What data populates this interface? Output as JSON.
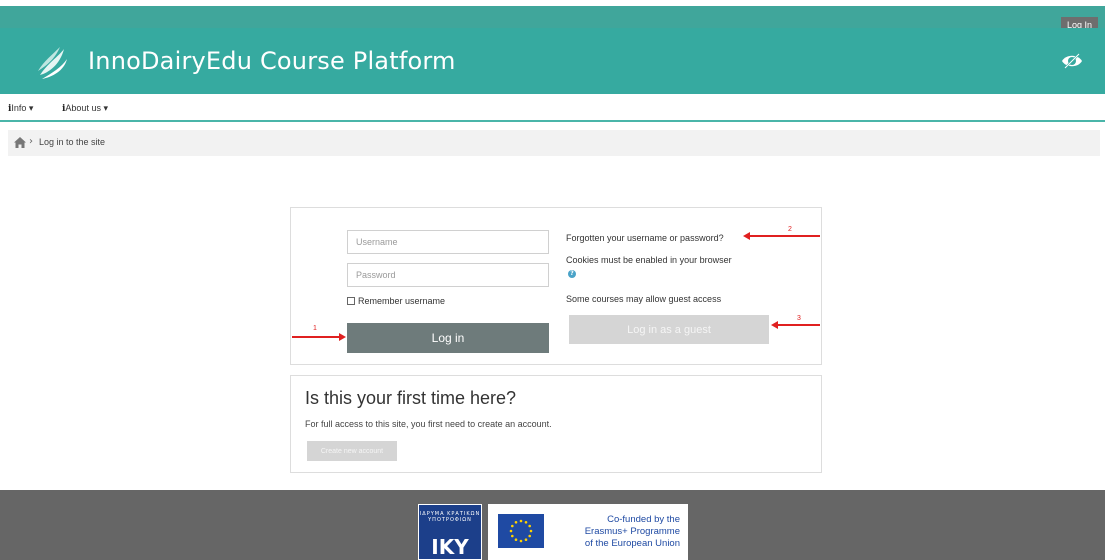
{
  "topbar": {
    "login_label": "Log In"
  },
  "header": {
    "title": "InnoDairyEdu Course Platform"
  },
  "nav": {
    "items": [
      {
        "icon": "i",
        "label": "Info ▾"
      },
      {
        "icon": "i",
        "label": "About us ▾"
      }
    ]
  },
  "breadcrumb": {
    "separator": "›",
    "current": "Log in to the site"
  },
  "login": {
    "username_placeholder": "Username",
    "password_placeholder": "Password",
    "remember_label": "Remember username",
    "login_button": "Log in",
    "forgot_link": "Forgotten your username or password?",
    "cookies_text": "Cookies must be enabled in your browser",
    "guest_text": "Some courses may allow guest access",
    "guest_button": "Log in as a guest"
  },
  "signup": {
    "title": "Is this your first time here?",
    "description": "For full access to this site, you first need to create an account.",
    "button": "Create new account"
  },
  "annotations": {
    "a1": "1",
    "a2": "2",
    "a3": "3"
  },
  "footer": {
    "iky_small": "ΙΔΡΥΜΑ ΚΡΑΤΙΚΩΝ ΥΠΟΤΡΟΦΙΩΝ",
    "iky_big": "IKY",
    "eu_line1": "Co-funded by the",
    "eu_line2": "Erasmus+ Programme",
    "eu_line3": "of the European Union"
  },
  "colors": {
    "teal": "#36aaa0",
    "annotation_red": "#e02020",
    "footer_gray": "#666666"
  }
}
